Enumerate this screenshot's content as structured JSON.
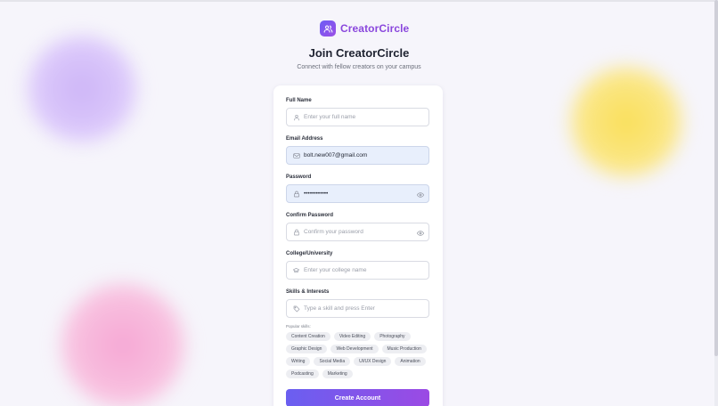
{
  "brand": {
    "name": "CreatorCircle",
    "accent": "#8a47dd",
    "gradient_start": "#6d5cf5",
    "gradient_end": "#9b4fe6"
  },
  "page": {
    "title": "Join CreatorCircle",
    "subtitle": "Connect with fellow creators on your campus"
  },
  "form": {
    "full_name": {
      "label": "Full Name",
      "placeholder": "Enter your full name",
      "value": "",
      "icon": "user-icon"
    },
    "email": {
      "label": "Email Address",
      "placeholder": "",
      "value": "bolt.new007@gmail.com",
      "icon": "mail-icon"
    },
    "password": {
      "label": "Password",
      "placeholder": "",
      "value": "••••••••••••",
      "icon": "lock-icon"
    },
    "confirm_password": {
      "label": "Confirm Password",
      "placeholder": "Confirm your password",
      "value": "",
      "icon": "lock-icon"
    },
    "college": {
      "label": "College/University",
      "placeholder": "Enter your college name",
      "value": "",
      "icon": "graduation-cap-icon"
    },
    "skills": {
      "label": "Skills & Interests",
      "placeholder": "Type a skill and press Enter",
      "value": "",
      "icon": "tag-icon"
    },
    "popular_skills_label": "Popular skills:",
    "popular_skills": [
      [
        "Content Creation",
        "Video Editing",
        "Photography"
      ],
      [
        "Graphic Design",
        "Web Development",
        "Music Production"
      ],
      [
        "Writing",
        "Social Media",
        "UI/UX Design",
        "Animation"
      ],
      [
        "Podcasting",
        "Marketing"
      ]
    ],
    "submit_label": "Create Account"
  },
  "colors": {
    "background": "#f6f5fb",
    "filled_field": "#e8effc",
    "blob_purple": "#cdb5f7",
    "blob_yellow": "#f9df58",
    "blob_pink": "#f6a7d4"
  }
}
